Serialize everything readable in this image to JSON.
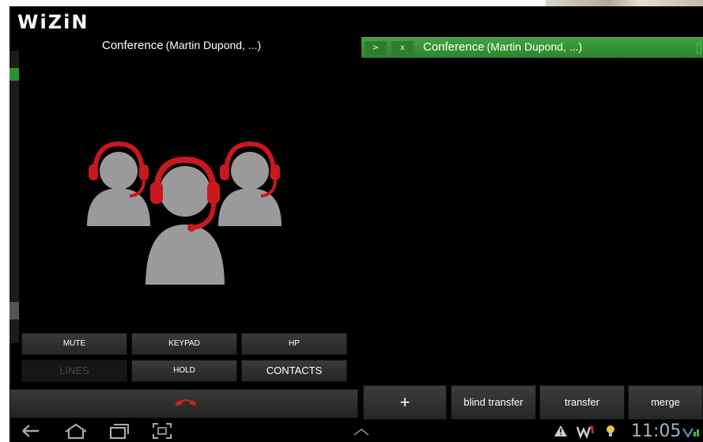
{
  "app": {
    "logo_text": "WiZiN"
  },
  "call": {
    "title": "Conference",
    "participants": "(Martin Dupond, ...)"
  },
  "tab": {
    "expand_label": ">",
    "close_label": "x",
    "title": "Conference",
    "participants": "(Martin Dupond, ...)"
  },
  "controls": {
    "mute": "MUTE",
    "keypad": "KEYPAD",
    "hp": "HP",
    "lines": "LINES",
    "hold": "HOLD",
    "contacts": "CONTACTS"
  },
  "actions": {
    "add": "+",
    "blind_transfer": "blind transfer",
    "transfer": "transfer",
    "merge": "merge"
  },
  "status": {
    "time": "11:05"
  },
  "colors": {
    "accent_green": "#3a9a3a",
    "hangup_red": "#c0282d",
    "headset_red": "#c8191e"
  },
  "icons": [
    "back-icon",
    "home-icon",
    "recent-apps-icon",
    "screenshot-icon",
    "up-chevron-icon",
    "warning-icon",
    "wizin-notification-icon",
    "bulb-icon",
    "wifi-icon"
  ]
}
